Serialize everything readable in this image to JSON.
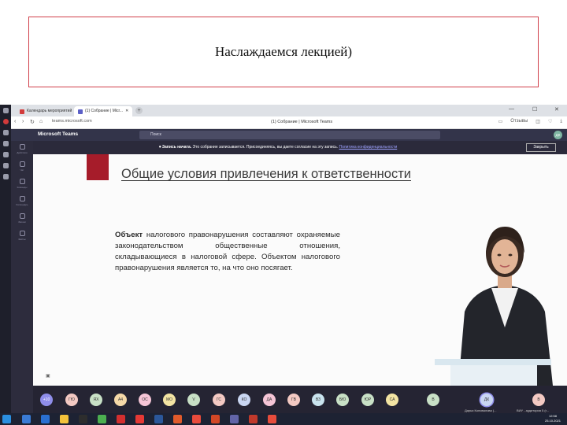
{
  "slide_header": {
    "title": "Наслаждаемся лекцией)"
  },
  "browser": {
    "tabs": [
      {
        "label": "Календарь мероприятий"
      },
      {
        "label": "(1) Собрание | Micr..."
      }
    ],
    "url": "teams.microsoft.com",
    "page_title": "(1) Собрание | Microsoft Teams",
    "actions": [
      "Отзывы"
    ]
  },
  "teams": {
    "app_name": "Microsoft Teams",
    "search_placeholder": "Поиск",
    "avatar_initials": "ДК",
    "rail": [
      "Действия",
      "Чат",
      "Команды",
      "Календарь",
      "Звонки",
      "Файлы"
    ],
    "notice": {
      "bold": "Запись начата.",
      "text": "Это собрание записывается. Присоединяясь, вы даете согласие на эту запись.",
      "link": "Политика конфиденциальности",
      "button": "Закрыть"
    }
  },
  "slide": {
    "title": "Общие условия привлечения к ответственности",
    "body_bold": "Объект",
    "body": "налогового правонарушения составляют охраняемые законодательством общественные отношения, складывающиеся в налоговой сфере. Объектом налогового правонарушения является то, на что оно посягает."
  },
  "call_controls": {
    "timer": ""
  },
  "participants": {
    "extra": "+10",
    "initials": [
      "ГЮ",
      "ЯХ",
      "А4",
      "ОС",
      "МО",
      "V",
      "ГС",
      "КО",
      "ДА",
      "ГВ",
      "ВЗ",
      "БЮ",
      "ЮР",
      "СА"
    ],
    "video": [
      {
        "initials": "В",
        "name": ""
      },
      {
        "initials": "ДК",
        "name": "Дарья Коновалова (..."
      },
      {
        "initials": "В",
        "name": "ВИУ - аудитория 5 (г..."
      }
    ]
  },
  "taskbar": {
    "time": "12:58",
    "date": "25.10.2021"
  },
  "colors": {
    "accent": "#c4314b",
    "teams_header": "#33344a",
    "slide_red": "#a61c2a"
  }
}
